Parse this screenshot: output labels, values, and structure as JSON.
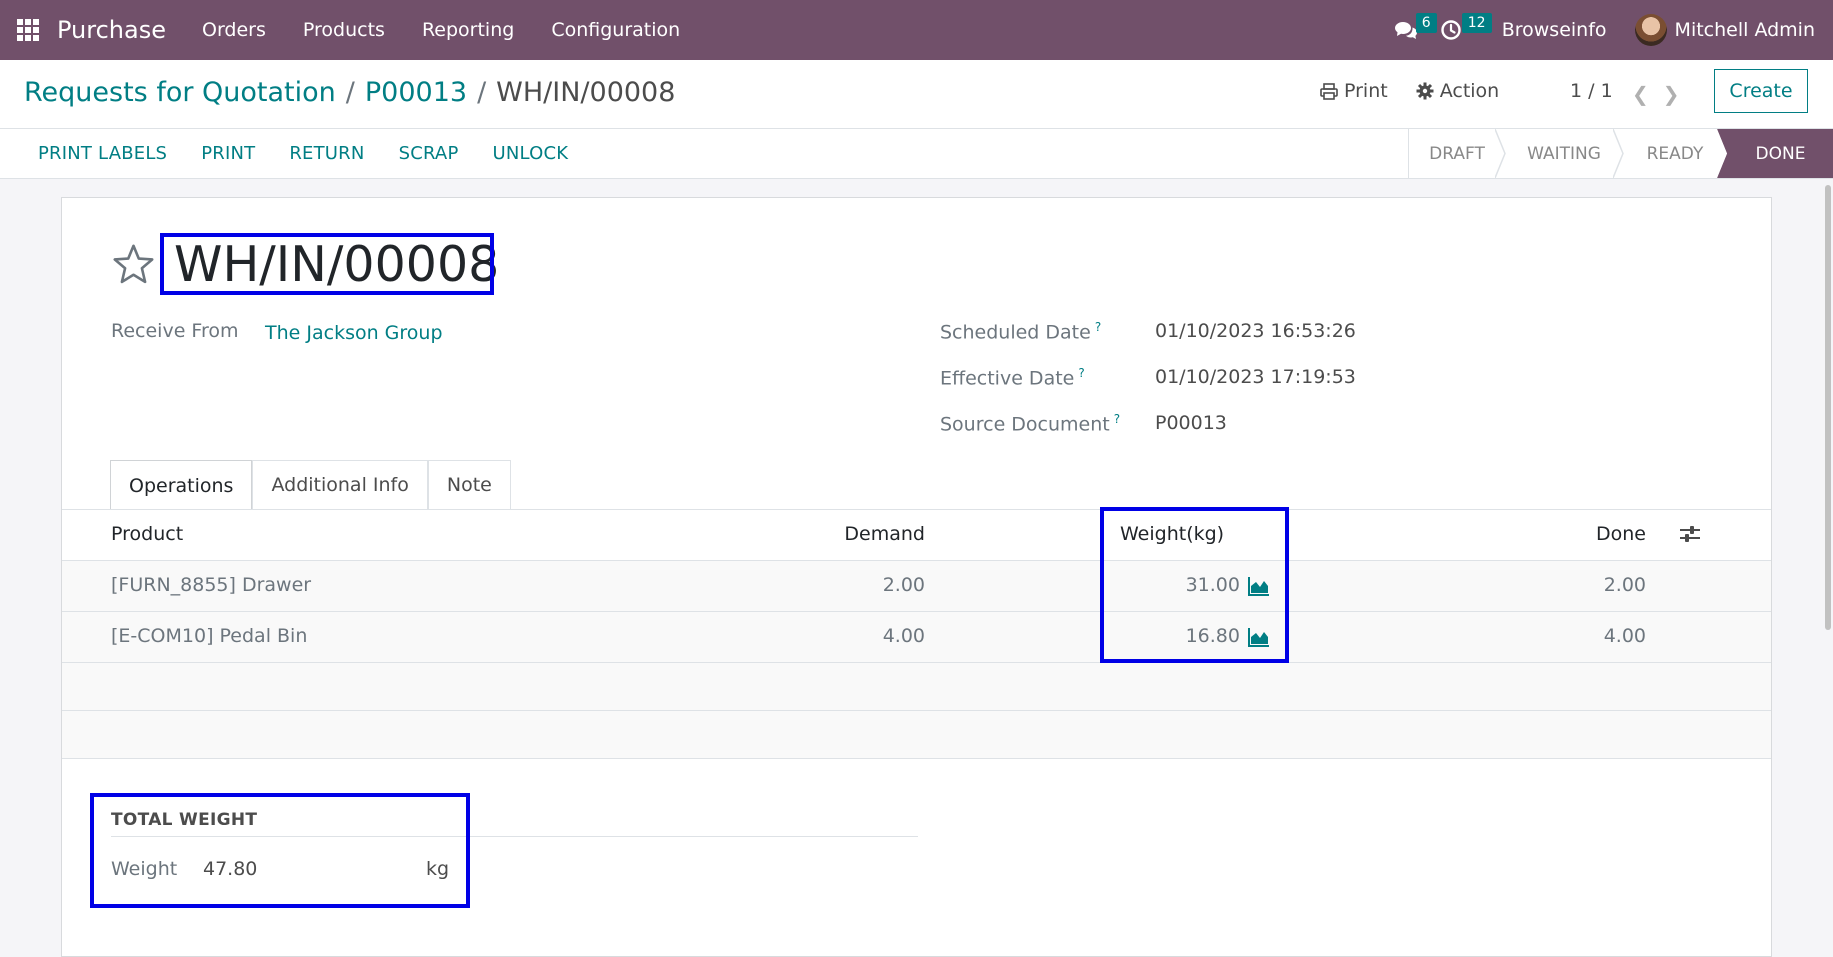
{
  "navbar": {
    "app_name": "Purchase",
    "menu": [
      "Orders",
      "Products",
      "Reporting",
      "Configuration"
    ],
    "messages_count": "6",
    "activities_count": "12",
    "company": "Browseinfo",
    "user": "Mitchell Admin",
    "bg_color": "#71506a"
  },
  "breadcrumb": {
    "items": [
      "Requests for Quotation",
      "P00013"
    ],
    "separator": "/",
    "current": "WH/IN/00008"
  },
  "control": {
    "print_label": "Print",
    "action_label": "Action",
    "pager": "1 / 1",
    "create_label": "Create"
  },
  "header_buttons": [
    "PRINT LABELS",
    "PRINT",
    "RETURN",
    "SCRAP",
    "UNLOCK"
  ],
  "stages": {
    "items": [
      "DRAFT",
      "WAITING",
      "READY",
      "DONE"
    ],
    "current": "DONE"
  },
  "record": {
    "name": "WH/IN/00008",
    "receive_from_label": "Receive From",
    "receive_from": "The Jackson Group",
    "scheduled_date_label": "Scheduled Date",
    "scheduled_date": "01/10/2023 16:53:26",
    "effective_date_label": "Effective Date",
    "effective_date": "01/10/2023 17:19:53",
    "source_document_label": "Source Document",
    "source_document": "P00013",
    "help_mark": "?"
  },
  "tabs": [
    "Operations",
    "Additional Info",
    "Note"
  ],
  "operations": {
    "columns": {
      "product": "Product",
      "demand": "Demand",
      "weight": "Weight(kg)",
      "done": "Done"
    },
    "rows": [
      {
        "product": "[FURN_8855] Drawer",
        "demand": "2.00",
        "weight": "31.00",
        "done": "2.00"
      },
      {
        "product": "[E-COM10] Pedal Bin",
        "demand": "4.00",
        "weight": "16.80",
        "done": "4.00"
      }
    ]
  },
  "total_weight": {
    "title": "TOTAL WEIGHT",
    "label": "Weight",
    "value": "47.80",
    "unit": "kg"
  },
  "colors": {
    "accent": "#017e84",
    "highlight": "#0000e6"
  }
}
